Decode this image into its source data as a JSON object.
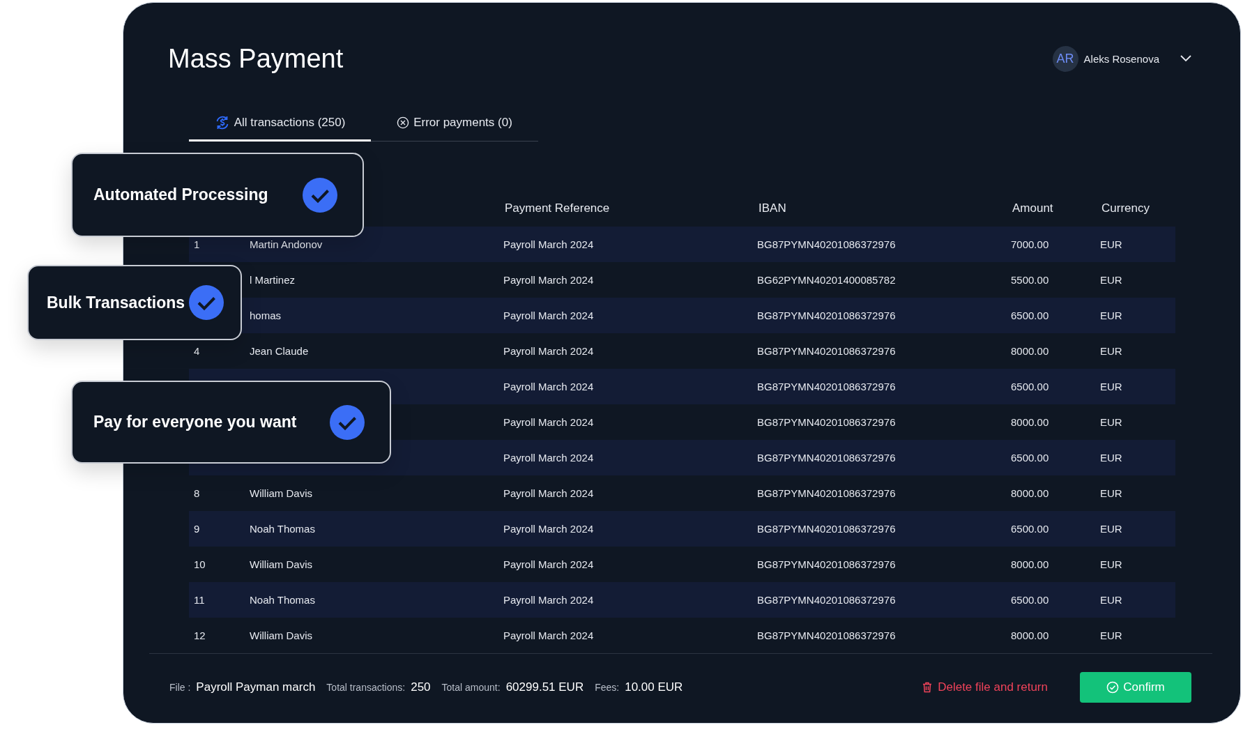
{
  "title": "Mass Payment",
  "user": {
    "initials": "AR",
    "name": "Aleks Rosenova"
  },
  "tabs": [
    {
      "label": "All transactions (250)",
      "kind": "all",
      "selected": true
    },
    {
      "label": "Error payments (0)",
      "kind": "error",
      "selected": false
    }
  ],
  "table": {
    "columns": [
      "Payment Reference",
      "IBAN",
      "Amount",
      "Currency"
    ],
    "rows": [
      {
        "number": "1",
        "name": "Martin Andonov",
        "reference": "Payroll March 2024",
        "iban": "BG87PYMN40201086372976",
        "amount": "7000.00",
        "currency": "EUR"
      },
      {
        "name": "l Martinez",
        "reference": "Payroll March 2024",
        "iban": "BG62PYMN40201400085782",
        "amount": "5500.00",
        "currency": "EUR"
      },
      {
        "name": "homas",
        "reference": "Payroll March 2024",
        "iban": "BG87PYMN40201086372976",
        "amount": "6500.00",
        "currency": "EUR"
      },
      {
        "number": "4",
        "name": "Jean Claude",
        "reference": "Payroll March 2024",
        "iban": "BG87PYMN40201086372976",
        "amount": "8000.00",
        "currency": "EUR"
      },
      {
        "reference": "Payroll March 2024",
        "iban": "BG87PYMN40201086372976",
        "amount": "6500.00",
        "currency": "EUR"
      },
      {
        "reference": "Payroll March 2024",
        "iban": "BG87PYMN40201086372976",
        "amount": "8000.00",
        "currency": "EUR"
      },
      {
        "reference": "Payroll March 2024",
        "iban": "BG87PYMN40201086372976",
        "amount": "6500.00",
        "currency": "EUR"
      },
      {
        "number": "8",
        "name": "William Davis",
        "reference": "Payroll March 2024",
        "iban": "BG87PYMN40201086372976",
        "amount": "8000.00",
        "currency": "EUR"
      },
      {
        "number": "9",
        "name": "Noah Thomas",
        "reference": "Payroll March 2024",
        "iban": "BG87PYMN40201086372976",
        "amount": "6500.00",
        "currency": "EUR"
      },
      {
        "number": "10",
        "name": "William Davis",
        "reference": "Payroll March 2024",
        "iban": "BG87PYMN40201086372976",
        "amount": "8000.00",
        "currency": "EUR"
      },
      {
        "number": "11",
        "name": "Noah Thomas",
        "reference": "Payroll March 2024",
        "iban": "BG87PYMN40201086372976",
        "amount": "6500.00",
        "currency": "EUR"
      },
      {
        "number": "12",
        "name": "William Davis",
        "reference": "Payroll March 2024",
        "iban": "BG87PYMN40201086372976",
        "amount": "8000.00",
        "currency": "EUR"
      }
    ]
  },
  "footer": {
    "items": [
      {
        "label": "File :",
        "value": "Payroll Payman march"
      },
      {
        "label": "Total transactions:",
        "value": "250"
      },
      {
        "label": "Total amount:",
        "value": "60299.51 EUR"
      },
      {
        "label": "Fees:",
        "value": "10.00 EUR"
      }
    ],
    "delete_button": "Delete file and return",
    "confirm_button": "Confirm"
  },
  "features": [
    {
      "label": "Automated Processing",
      "checked": true
    },
    {
      "label": "Bulk Transactions",
      "checked": true
    },
    {
      "label": "Pay for everyone you want",
      "checked": true
    }
  ]
}
